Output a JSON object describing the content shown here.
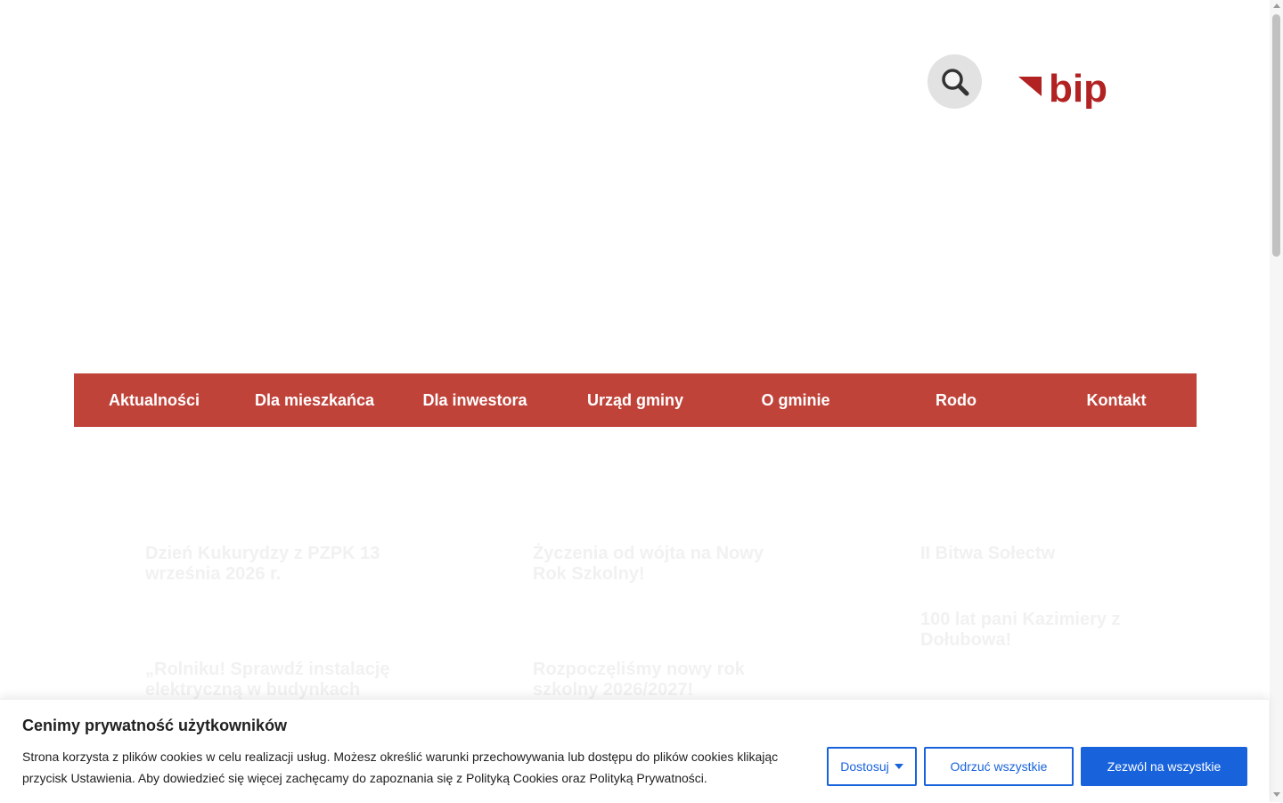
{
  "header": {
    "search_label": "search",
    "logo_text": "bip",
    "logo_color": "#b22222"
  },
  "nav": {
    "items": [
      "Aktualności",
      "Dla mieszkańca",
      "Dla inwestora",
      "Urząd gminy",
      "O gminie",
      "Rodo",
      "Kontakt"
    ]
  },
  "news": {
    "titles": [
      "Dzień Kukurydzy z PZPK 13 września 2026 r.",
      "Życzenia od wójta na Nowy Rok Szkolny!",
      "II Bitwa Sołectw",
      "100 lat pani Kazimiery z Dołubowa!",
      "„Rolniku! Sprawdź instalację elektryczną w budynkach",
      "Rozpoczęliśmy nowy rok szkolny 2026/2027!"
    ]
  },
  "cookie": {
    "title": "Cenimy prywatność użytkowników",
    "text": "Strona korzysta z plików cookies w celu realizacji usług. Możesz określić warunki przechowywania lub dostępu do plików cookies klikając przycisk Ustawienia. Aby dowiedzieć się więcej zachęcamy do zapoznania się z Polityką Cookies oraz Polityką Prywatności.",
    "customize_label": "Dostosuj",
    "reject_label": "Odrzuć wszystkie",
    "accept_label": "Zezwól na wszystkie"
  },
  "colors": {
    "nav_bg": "#c0433a",
    "accent": "#1863dc"
  }
}
